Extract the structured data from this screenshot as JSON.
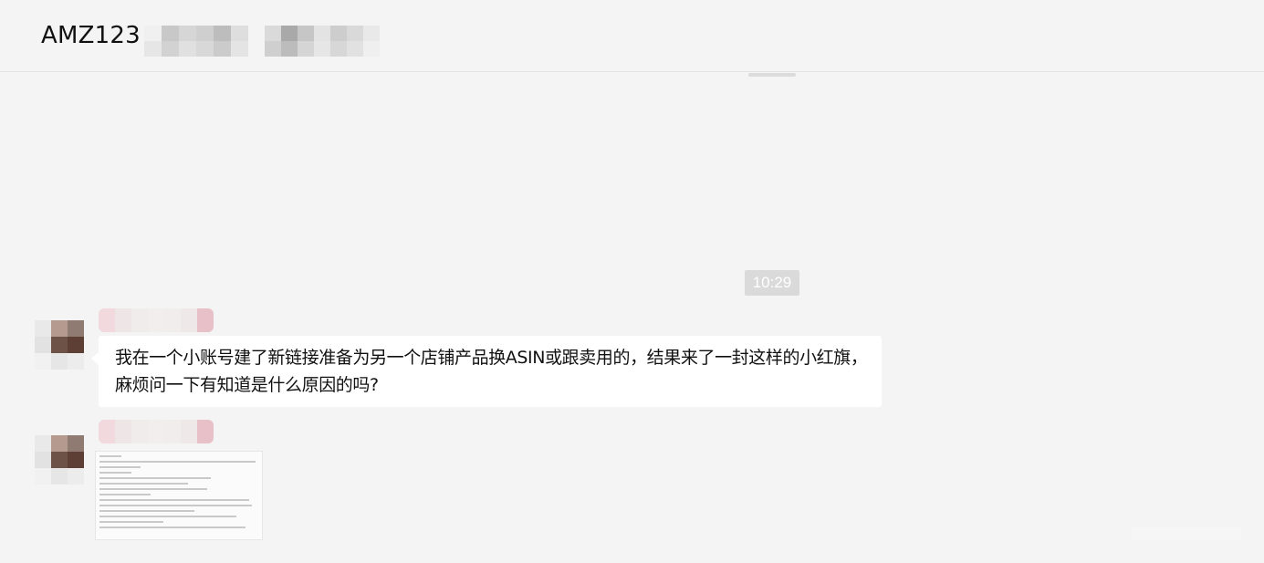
{
  "header": {
    "title": "AMZ123"
  },
  "chat": {
    "timestamp": "10:29",
    "messages": [
      {
        "type": "text",
        "text": "我在一个小账号建了新链接准备为另一个店铺产品换ASIN或跟卖用的，结果来了一封这样的小红旗，麻烦问一下有知道是什么原因的吗?"
      },
      {
        "type": "image",
        "image_icon": "screenshot-thumbnail"
      }
    ]
  },
  "colors": {
    "background": "#f4f4f4",
    "bubble": "#ffffff",
    "timestamp_bg": "#dadada",
    "text": "#111111"
  }
}
